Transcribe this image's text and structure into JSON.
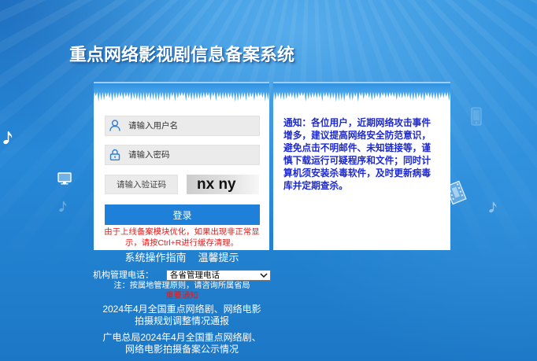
{
  "title": "重点网络影视剧信息备案系统",
  "login": {
    "username_placeholder": "请输入用户名",
    "password_placeholder": "请输入密码",
    "captcha_placeholder": "请输入验证码",
    "captcha_text": "nx ny",
    "submit_label": "登录",
    "cache_notice": "由于上线备案模块优化，如果出现非正常显示，请按Ctrl+R进行缓存清理。"
  },
  "notice": {
    "text": "通知：各位用户，近期网络攻击事件增多，建议提高网络安全防范意识，避免点击不明邮件、未知链接等，谨慎下载运行可疑程序和文件；同时计算机须安装杀毒软件，及时更新病毒库并定期查杀。"
  },
  "links": {
    "guide": "系统操作指南",
    "tips": "温馨提示"
  },
  "contact": {
    "label": "机构管理电话：",
    "selected": "各省管理电话",
    "note": "注：按属地管理原则，请咨询所属省局"
  },
  "announcements": {
    "heading": "重要通知",
    "items": [
      "2024年4月全国重点网络剧、网络电影拍摄规划调整情况通报",
      "广电总局2024年4月全国重点网络剧、网络电影拍摄备案公示情况"
    ]
  },
  "icons": {
    "username": "user-icon",
    "password": "lock-icon",
    "select": "chevron-down-icon",
    "decor": [
      "music-note-icon",
      "monitor-icon",
      "film-icon",
      "phone-icon"
    ]
  },
  "colors": {
    "background_top": "#2b8edb",
    "background_bottom": "#1c78c6",
    "header_band": "#3a9be6",
    "button": "#1e80d8",
    "notice_text": "#1c28d0",
    "warning_text": "#e31b1b"
  }
}
